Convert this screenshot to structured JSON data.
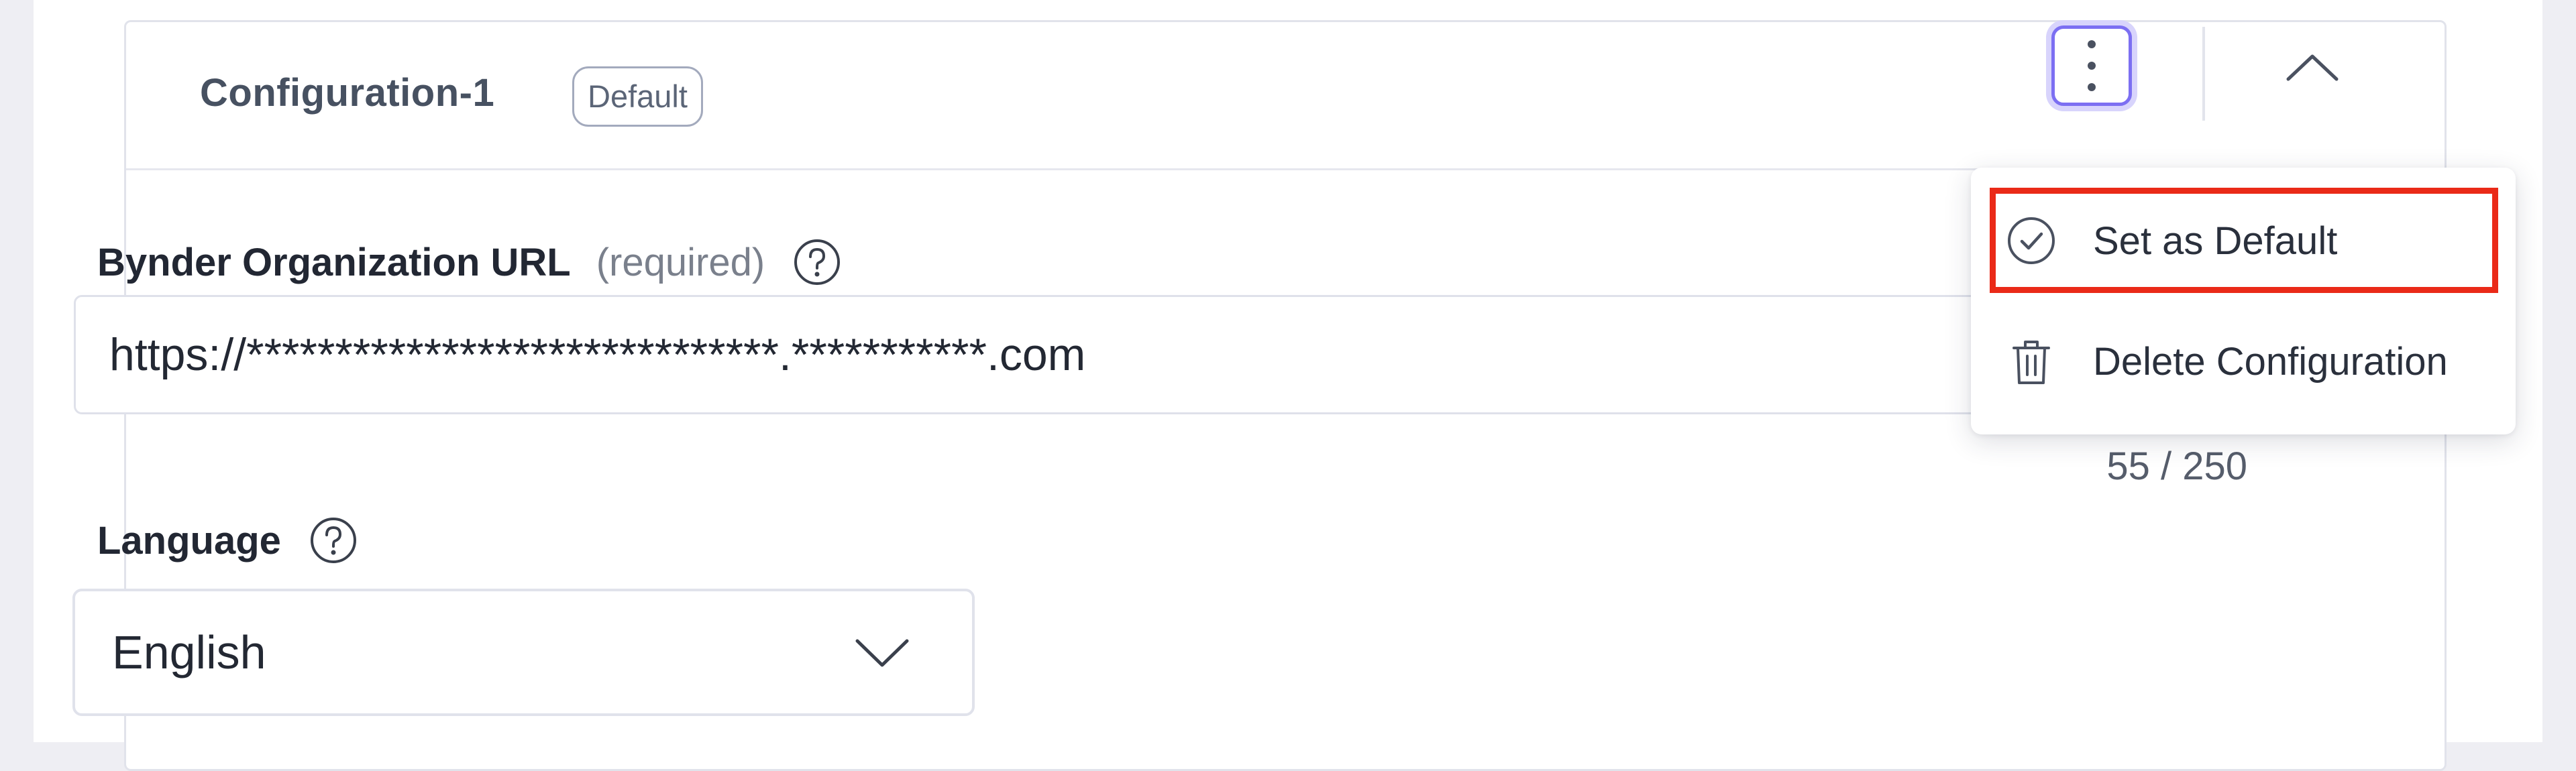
{
  "config": {
    "title": "Configuration-1",
    "badge": "Default"
  },
  "icons": {
    "menu": "kebab-vertical-icon",
    "collapse": "chevron-up-icon",
    "help": "question-circle-icon",
    "dropdown": "chevron-down-icon",
    "set_default": "check-circle-icon",
    "delete": "trash-icon"
  },
  "url_field": {
    "label": "Bynder Organization URL",
    "required_text": "(required)",
    "value": "https://******************************.***********.com",
    "char_count": "55 / 250"
  },
  "language_field": {
    "label": "Language",
    "selected": "English"
  },
  "menu": {
    "items": [
      {
        "label": "Set as Default"
      },
      {
        "label": "Delete Configuration"
      }
    ]
  },
  "colors": {
    "accent": "#7c6ff2",
    "highlight": "#ea2a18"
  }
}
